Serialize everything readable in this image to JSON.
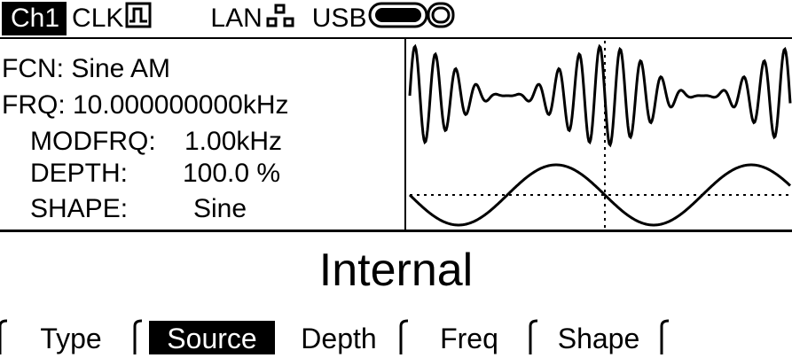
{
  "status": {
    "channel": "Ch1",
    "clk_label": "CLK",
    "clk_icon": "square-wave-icon",
    "lan_label": "LAN",
    "lan_icon": "network-icon",
    "usb_label": "USB",
    "usb_icon": "usb-drive-icon"
  },
  "params": {
    "fcn": "FCN: Sine AM",
    "frq": "FRQ: 10.000000000kHz",
    "modfrq_label": "MODFRQ:",
    "modfrq_value": "1.00kHz",
    "depth_label": "DEPTH:",
    "depth_value": "100.0 %",
    "shape_label": "SHAPE:",
    "shape_value": "Sine"
  },
  "main_value": "Internal",
  "softkeys": [
    {
      "label": "Type",
      "selected": false
    },
    {
      "label": "Source",
      "selected": true
    },
    {
      "label": "Depth",
      "selected": false
    },
    {
      "label": "Freq",
      "selected": false
    },
    {
      "label": "Shape",
      "selected": false
    },
    {
      "label": "",
      "selected": false
    }
  ],
  "colors": {
    "foreground": "#000000",
    "background": "#ffffff"
  }
}
